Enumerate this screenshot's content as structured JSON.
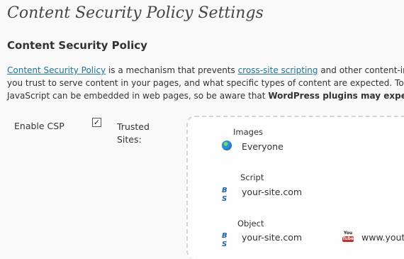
{
  "page": {
    "title": "Content Security Policy Settings"
  },
  "section": {
    "title": "Content Security Policy"
  },
  "intro": {
    "csp_link": "Content Security Policy",
    "line1_a": " is a mechanism that prevents ",
    "xss_link": "cross-site scripting",
    "line1_b": " and other content-in",
    "line2": "you trust to serve content in your pages, and what specific types of content are expected. To p",
    "line3_a": "JavaScript can be embedded in web pages, so be aware that ",
    "line3_bold": "WordPress plugins may exper"
  },
  "settings": {
    "enable_label": "Enable CSP",
    "enable_checked": true,
    "checkmark": "✓",
    "trusted_label": "Trusted Sites:"
  },
  "trusted_sites": {
    "images": {
      "label": "Images",
      "entries": [
        {
          "icon": "globe-icon",
          "text": "Everyone"
        }
      ]
    },
    "script": {
      "label": "Script",
      "entries": [
        {
          "icon": "bs-icon",
          "text": "your-site.com"
        }
      ]
    },
    "object": {
      "label": "Object",
      "entries": [
        {
          "icon": "bs-icon",
          "text": "your-site.com"
        },
        {
          "icon": "youtube-icon",
          "text": "www.yout"
        }
      ]
    }
  }
}
